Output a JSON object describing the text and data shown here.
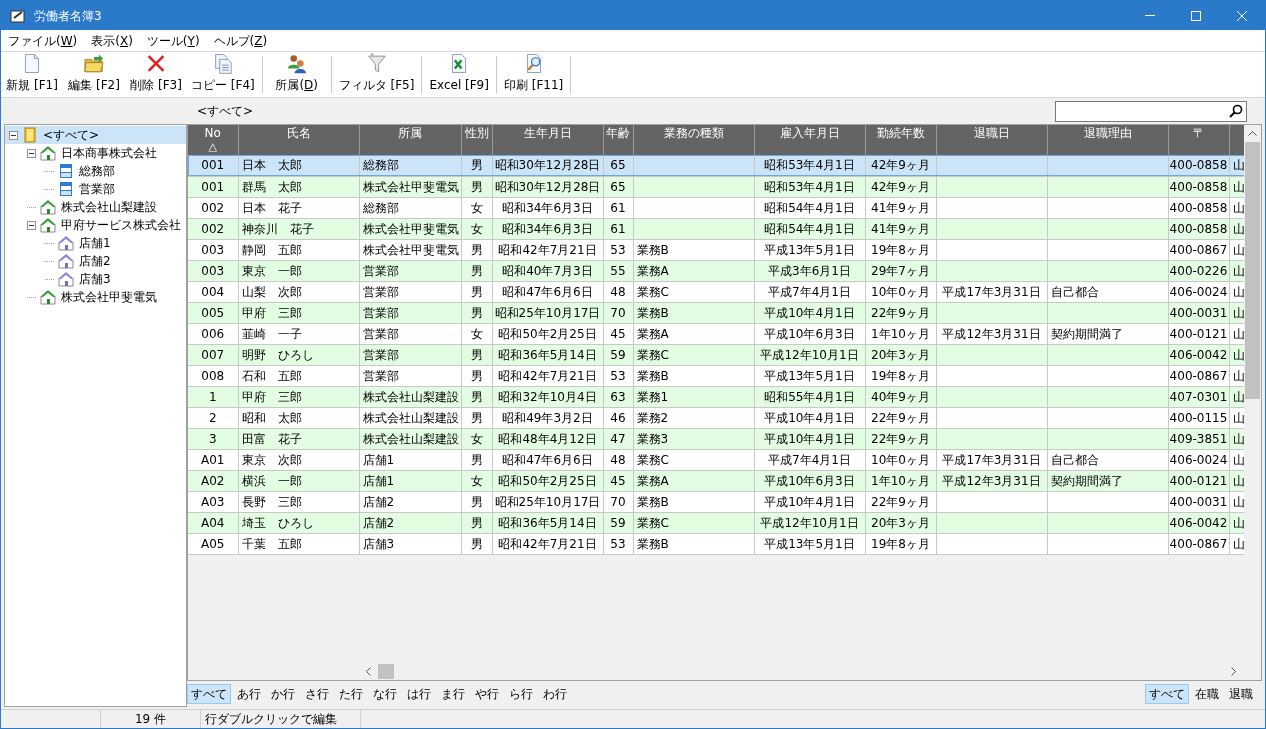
{
  "window": {
    "title": "労働者名簿3"
  },
  "menu": [
    {
      "text": "ファイル(",
      "access_key": "W",
      "after": ")"
    },
    {
      "text": "表示(",
      "access_key": "X",
      "after": ")"
    },
    {
      "text": "ツール(",
      "access_key": "Y",
      "after": ")"
    },
    {
      "text": "ヘルプ(",
      "access_key": "Z",
      "after": ")"
    }
  ],
  "toolbar": [
    [
      {
        "kind": "new",
        "label": "新規 [F1]"
      },
      {
        "kind": "edit",
        "label": "編集 [F2]"
      },
      {
        "kind": "delete",
        "label": "削除 [F3]"
      },
      {
        "kind": "copy",
        "label": "コピー [F4]"
      }
    ],
    [
      {
        "kind": "people",
        "text": "所属(",
        "access_key": "D",
        "after": ")"
      }
    ],
    [
      {
        "kind": "filter",
        "label": "フィルタ [F5]"
      }
    ],
    [
      {
        "kind": "excel",
        "label": "Excel [F9]"
      }
    ],
    [
      {
        "kind": "print",
        "label": "印刷 [F11]"
      }
    ]
  ],
  "breadcrumb": "<すべて>",
  "tree": [
    {
      "label": "<すべて>",
      "kind": "root",
      "selected": true,
      "expanded": true,
      "children": [
        {
          "label": "日本商事株式会社",
          "kind": "company",
          "selected": false,
          "expanded": true,
          "children": [
            {
              "label": "総務部",
              "kind": "department",
              "selected": false
            },
            {
              "label": "営業部",
              "kind": "department",
              "selected": false
            }
          ]
        },
        {
          "label": "株式会社山梨建設",
          "kind": "company",
          "selected": false
        },
        {
          "label": "甲府サービス株式会社",
          "kind": "company",
          "selected": false,
          "expanded": true,
          "children": [
            {
              "label": "店舗1",
              "kind": "store",
              "selected": false
            },
            {
              "label": "店舗2",
              "kind": "store",
              "selected": false
            },
            {
              "label": "店舗3",
              "kind": "store",
              "selected": false
            }
          ]
        },
        {
          "label": "株式会社甲斐電気",
          "kind": "company",
          "selected": false
        }
      ]
    }
  ],
  "table": {
    "columns": [
      {
        "label": "No",
        "sort": "△"
      },
      {
        "label": "氏名"
      },
      {
        "label": "所属"
      },
      {
        "label": "性別"
      },
      {
        "label": "生年月日"
      },
      {
        "label": "年齢"
      },
      {
        "label": "業務の種類"
      },
      {
        "label": "雇入年月日"
      },
      {
        "label": "勤続年数"
      },
      {
        "label": "退職日"
      },
      {
        "label": "退職理由"
      },
      {
        "label": "〒"
      }
    ],
    "rows": [
      {
        "selected": true,
        "cells": [
          "001",
          "日本　太郎",
          "総務部",
          "男",
          "昭和30年12月28日",
          "65",
          "",
          "昭和53年4月1日",
          "42年9ヶ月",
          "",
          "",
          "400-0858",
          "山"
        ]
      },
      {
        "selected": false,
        "cells": [
          "001",
          "群馬　太郎",
          "株式会社甲斐電気",
          "男",
          "昭和30年12月28日",
          "65",
          "",
          "昭和53年4月1日",
          "42年9ヶ月",
          "",
          "",
          "400-0858",
          "山"
        ]
      },
      {
        "selected": false,
        "cells": [
          "002",
          "日本　花子",
          "総務部",
          "女",
          "昭和34年6月3日",
          "61",
          "",
          "昭和54年4月1日",
          "41年9ヶ月",
          "",
          "",
          "400-0858",
          "山"
        ]
      },
      {
        "selected": false,
        "cells": [
          "002",
          "神奈川　花子",
          "株式会社甲斐電気",
          "女",
          "昭和34年6月3日",
          "61",
          "",
          "昭和54年4月1日",
          "41年9ヶ月",
          "",
          "",
          "400-0858",
          "山"
        ]
      },
      {
        "selected": false,
        "cells": [
          "003",
          "静岡　五郎",
          "株式会社甲斐電気",
          "男",
          "昭和42年7月21日",
          "53",
          "業務B",
          "平成13年5月1日",
          "19年8ヶ月",
          "",
          "",
          "400-0867",
          "山"
        ]
      },
      {
        "selected": false,
        "cells": [
          "003",
          "東京　一郎",
          "営業部",
          "男",
          "昭和40年7月3日",
          "55",
          "業務A",
          "平成3年6月1日",
          "29年7ヶ月",
          "",
          "",
          "400-0226",
          "山"
        ]
      },
      {
        "selected": false,
        "cells": [
          "004",
          "山梨　次郎",
          "営業部",
          "男",
          "昭和47年6月6日",
          "48",
          "業務C",
          "平成7年4月1日",
          "10年0ヶ月",
          "平成17年3月31日",
          "自己都合",
          "406-0024",
          "山"
        ]
      },
      {
        "selected": false,
        "cells": [
          "005",
          "甲府　三郎",
          "営業部",
          "男",
          "昭和25年10月17日",
          "70",
          "業務B",
          "平成10年4月1日",
          "22年9ヶ月",
          "",
          "",
          "400-0031",
          "山"
        ]
      },
      {
        "selected": false,
        "cells": [
          "006",
          "韮崎　一子",
          "営業部",
          "女",
          "昭和50年2月25日",
          "45",
          "業務A",
          "平成10年6月3日",
          "1年10ヶ月",
          "平成12年3月31日",
          "契約期間満了",
          "400-0121",
          "山"
        ]
      },
      {
        "selected": false,
        "cells": [
          "007",
          "明野　ひろし",
          "営業部",
          "男",
          "昭和36年5月14日",
          "59",
          "業務C",
          "平成12年10月1日",
          "20年3ヶ月",
          "",
          "",
          "406-0042",
          "山"
        ]
      },
      {
        "selected": false,
        "cells": [
          "008",
          "石和　五郎",
          "営業部",
          "男",
          "昭和42年7月21日",
          "53",
          "業務B",
          "平成13年5月1日",
          "19年8ヶ月",
          "",
          "",
          "400-0867",
          "山"
        ]
      },
      {
        "selected": false,
        "cells": [
          "1",
          "甲府　三郎",
          "株式会社山梨建設",
          "男",
          "昭和32年10月4日",
          "63",
          "業務1",
          "昭和55年4月1日",
          "40年9ヶ月",
          "",
          "",
          "407-0301",
          "山"
        ]
      },
      {
        "selected": false,
        "cells": [
          "2",
          "昭和　太郎",
          "株式会社山梨建設",
          "男",
          "昭和49年3月2日",
          "46",
          "業務2",
          "平成10年4月1日",
          "22年9ヶ月",
          "",
          "",
          "400-0115",
          "山"
        ]
      },
      {
        "selected": false,
        "cells": [
          "3",
          "田富　花子",
          "株式会社山梨建設",
          "女",
          "昭和48年4月12日",
          "47",
          "業務3",
          "平成10年4月1日",
          "22年9ヶ月",
          "",
          "",
          "409-3851",
          "山"
        ]
      },
      {
        "selected": false,
        "cells": [
          "A01",
          "東京　次郎",
          "店舗1",
          "男",
          "昭和47年6月6日",
          "48",
          "業務C",
          "平成7年4月1日",
          "10年0ヶ月",
          "平成17年3月31日",
          "自己都合",
          "406-0024",
          "山"
        ]
      },
      {
        "selected": false,
        "cells": [
          "A02",
          "横浜　一郎",
          "店舗1",
          "女",
          "昭和50年2月25日",
          "45",
          "業務A",
          "平成10年6月3日",
          "1年10ヶ月",
          "平成12年3月31日",
          "契約期間満了",
          "400-0121",
          "山"
        ]
      },
      {
        "selected": false,
        "cells": [
          "A03",
          "長野　三郎",
          "店舗2",
          "男",
          "昭和25年10月17日",
          "70",
          "業務B",
          "平成10年4月1日",
          "22年9ヶ月",
          "",
          "",
          "400-0031",
          "山"
        ]
      },
      {
        "selected": false,
        "cells": [
          "A04",
          "埼玉　ひろし",
          "店舗2",
          "男",
          "昭和36年5月14日",
          "59",
          "業務C",
          "平成12年10月1日",
          "20年3ヶ月",
          "",
          "",
          "406-0042",
          "山"
        ]
      },
      {
        "selected": false,
        "cells": [
          "A05",
          "千葉　五郎",
          "店舗3",
          "男",
          "昭和42年7月21日",
          "53",
          "業務B",
          "平成13年5月1日",
          "19年8ヶ月",
          "",
          "",
          "400-0867",
          "山"
        ]
      }
    ]
  },
  "kana_tabs": [
    {
      "label": "すべて",
      "selected": true
    },
    {
      "label": "あ行",
      "selected": false
    },
    {
      "label": "か行",
      "selected": false
    },
    {
      "label": "さ行",
      "selected": false
    },
    {
      "label": "た行",
      "selected": false
    },
    {
      "label": "な行",
      "selected": false
    },
    {
      "label": "は行",
      "selected": false
    },
    {
      "label": "ま行",
      "selected": false
    },
    {
      "label": "や行",
      "selected": false
    },
    {
      "label": "ら行",
      "selected": false
    },
    {
      "label": "わ行",
      "selected": false
    }
  ],
  "status_tabs": [
    {
      "label": "すべて",
      "selected": true
    },
    {
      "label": "在職",
      "selected": false
    },
    {
      "label": "退職",
      "selected": false
    }
  ],
  "status_bar": {
    "count": "19 件",
    "hint": "行ダブルクリックで編集"
  }
}
